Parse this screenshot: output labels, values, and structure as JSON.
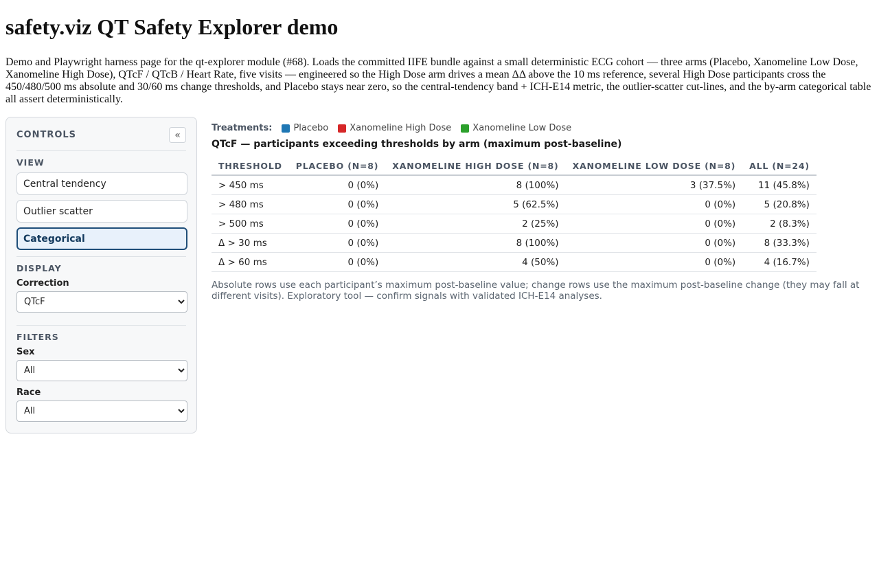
{
  "page": {
    "title": "safety.viz QT Safety Explorer demo",
    "intro": "Demo and Playwright harness page for the qt-explorer module (#68). Loads the committed IIFE bundle against a small deterministic ECG cohort — three arms (Placebo, Xanomeline Low Dose, Xanomeline High Dose), QTcF / QTcB / Heart Rate, five visits — engineered so the High Dose arm drives a mean ΔΔ above the 10 ms reference, several High Dose participants cross the 450/480/500 ms absolute and 30/60 ms change thresholds, and Placebo stays near zero, so the central-tendency band + ICH-E14 metric, the outlier-scatter cut-lines, and the by-arm categorical table all assert deterministically."
  },
  "controls": {
    "title": "CONTROLS",
    "collapse_label": "«",
    "view_label": "VIEW",
    "views": {
      "central": "Central tendency",
      "outlier": "Outlier scatter",
      "categorical": "Categorical"
    },
    "display_label": "DISPLAY",
    "correction_label": "Correction",
    "correction_value": "QTcF",
    "filters_label": "FILTERS",
    "sex_label": "Sex",
    "sex_value": "All",
    "race_label": "Race",
    "race_value": "All"
  },
  "legend": {
    "title": "Treatments:",
    "items": [
      {
        "label": "Placebo",
        "color": "#1f77b4"
      },
      {
        "label": "Xanomeline High Dose",
        "color": "#d62728"
      },
      {
        "label": "Xanomeline Low Dose",
        "color": "#2ca02c"
      }
    ]
  },
  "table": {
    "title": "QTcF — participants exceeding thresholds by arm (maximum post-baseline)",
    "headers": [
      "THRESHOLD",
      "PLACEBO (N=8)",
      "XANOMELINE HIGH DOSE (N=8)",
      "XANOMELINE LOW DOSE (N=8)",
      "ALL (N=24)"
    ],
    "rows": [
      [
        "> 450 ms",
        "0 (0%)",
        "8 (100%)",
        "3 (37.5%)",
        "11 (45.8%)"
      ],
      [
        "> 480 ms",
        "0 (0%)",
        "5 (62.5%)",
        "0 (0%)",
        "5 (20.8%)"
      ],
      [
        "> 500 ms",
        "0 (0%)",
        "2 (25%)",
        "0 (0%)",
        "2 (8.3%)"
      ],
      [
        "Δ > 30 ms",
        "0 (0%)",
        "8 (100%)",
        "0 (0%)",
        "8 (33.3%)"
      ],
      [
        "Δ > 60 ms",
        "0 (0%)",
        "4 (50%)",
        "0 (0%)",
        "4 (16.7%)"
      ]
    ],
    "note": "Absolute rows use each participant’s maximum post-baseline value; change rows use the maximum post-baseline change (they may fall at different visits). Exploratory tool — confirm signals with validated ICH-E14 analyses."
  }
}
